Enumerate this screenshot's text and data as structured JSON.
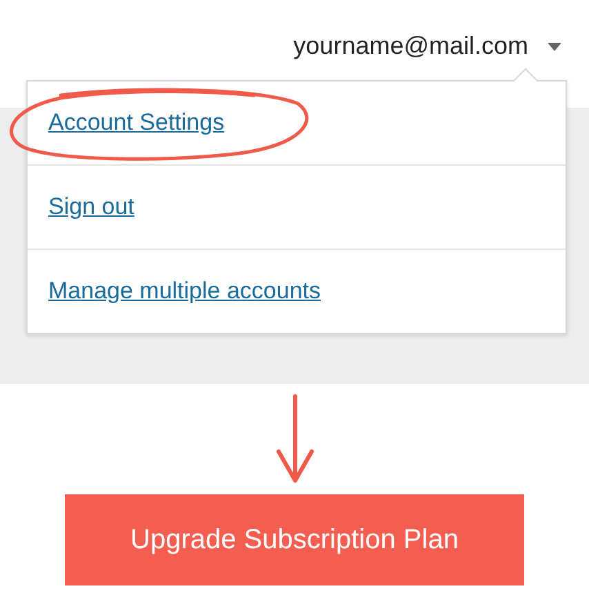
{
  "account": {
    "email": "yourname@mail.com"
  },
  "menu": {
    "items": [
      {
        "label": "Account Settings",
        "circled": true
      },
      {
        "label": "Sign out",
        "circled": false
      },
      {
        "label": "Manage multiple accounts",
        "circled": false
      }
    ]
  },
  "action": {
    "label": "Upgrade Subscription Plan"
  }
}
